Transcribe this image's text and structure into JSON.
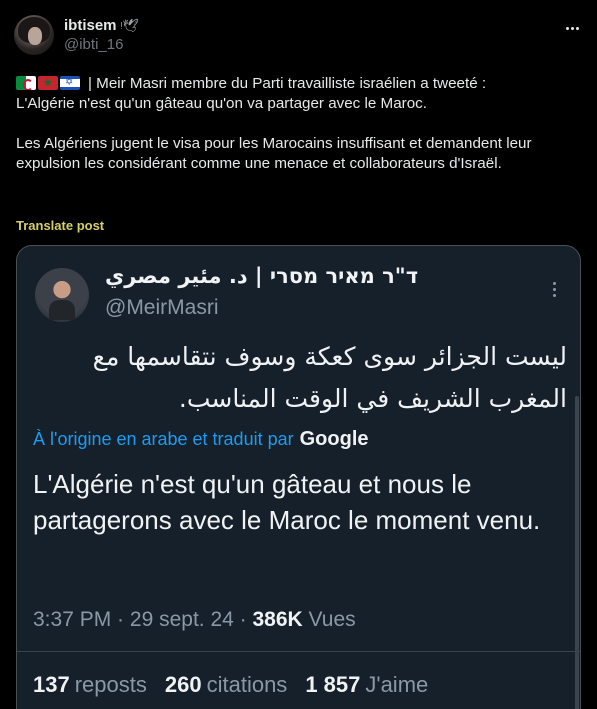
{
  "author": {
    "display_name": "ibtisem",
    "badge_icon": "dove-icon",
    "handle": "@ibti_16"
  },
  "tweet": {
    "flags": [
      "algeria-flag",
      "morocco-flag",
      "israel-flag"
    ],
    "text": "| Meir Masri membre du Parti travailliste israélien a tweeté :\nL'Algérie n'est qu'un gâteau qu'on va partager avec le Maroc.\n\nLes Algériens jugent le visa pour les Marocains insuffisant et demandent leur expulsion les considérant comme une menace et collaborateurs d'Israël.",
    "translate_label": "Translate post"
  },
  "quoted": {
    "display_name": "ד\"ר מאיר מסרי | د. مئير مصري",
    "handle": "@MeirMasri",
    "original_text": "ليست الجزائر سوى كعكة وسوف نتقاسمها مع المغرب الشريف في الوقت المناسب.",
    "origin_label": "À l'origine en arabe et traduit par",
    "origin_brand": "Google",
    "translated_text": "L'Algérie n'est qu'un gâteau et nous le partagerons avec le Maroc le moment venu.",
    "time": "3:37 PM",
    "date": "29 sept. 24",
    "views_count": "386K",
    "views_label": "Vues",
    "reposts_count": "137",
    "reposts_label": "reposts",
    "quotes_count": "260",
    "quotes_label": "citations",
    "likes_count": "1 857",
    "likes_label": "J'aime"
  },
  "colors": {
    "background": "#000000",
    "card_background": "#15202b",
    "link_blue": "#1d9bf0",
    "translate_yellow": "#d6cf6a",
    "muted": "#71767b"
  }
}
